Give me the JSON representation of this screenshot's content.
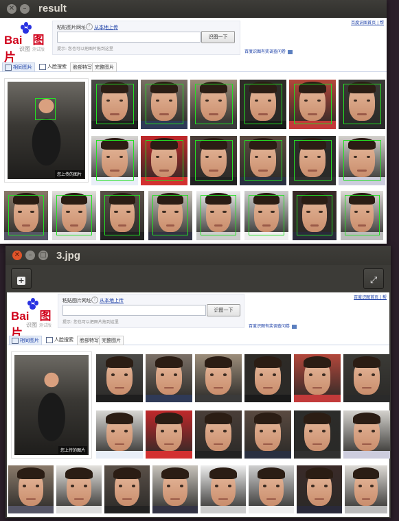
{
  "windows": {
    "result": {
      "title": "result"
    },
    "image_viewer": {
      "title": "3.jpg"
    }
  },
  "page": {
    "logo": {
      "text": "Bai",
      "text2": "图片",
      "sub": "识图",
      "beta": "测试版"
    },
    "search": {
      "label": "粘贴图片网址",
      "help": "?",
      "upload_link": "从本地上传",
      "input_value": "",
      "button": "识图一下",
      "hint": "提示: 您也可以把图片拖到这里"
    },
    "top_links": "百度识图首页 | 帮",
    "survey_link": "百度识图有奖调查问卷",
    "tabs": [
      {
        "label": "相同图片"
      },
      {
        "label": "人脸搜索"
      },
      {
        "label": "脸部特写"
      },
      {
        "label": "完整图片"
      }
    ],
    "query_image_label": "您上传的图片"
  },
  "colors": {
    "face_box": "#24e024",
    "logo_red": "#d0021b",
    "logo_blue": "#2932e1",
    "link": "#1a3ea6"
  },
  "icons": {
    "close": "close-icon",
    "minimize": "minimize-icon",
    "maximize": "maximize-icon",
    "add": "add-icon",
    "fullscreen": "fullscreen-icon"
  }
}
